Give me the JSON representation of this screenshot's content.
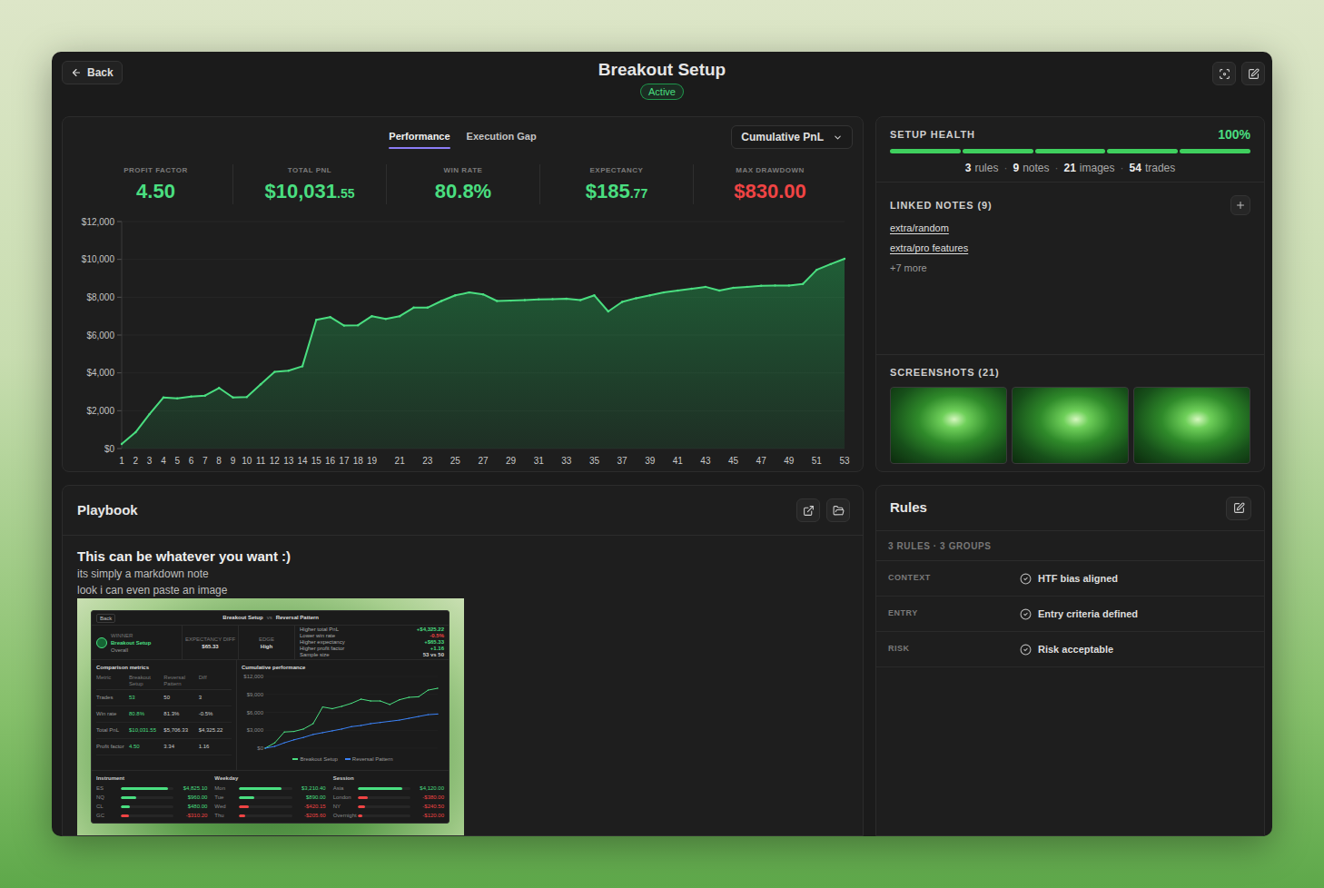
{
  "header": {
    "back": "Back",
    "title": "Breakout Setup",
    "status": "Active"
  },
  "performance": {
    "tabs": [
      {
        "label": "Performance",
        "selected": true
      },
      {
        "label": "Execution Gap",
        "selected": false
      }
    ],
    "dropdown": "Cumulative PnL",
    "stats": [
      {
        "label": "PROFIT FACTOR",
        "value": "4.50",
        "color": "#4ade80"
      },
      {
        "label": "TOTAL PNL",
        "value": "$10,031",
        "cents": ".55",
        "color": "#4ade80"
      },
      {
        "label": "WIN RATE",
        "value": "80.8%",
        "color": "#4ade80"
      },
      {
        "label": "EXPECTANCY",
        "value": "$185",
        "cents": ".77",
        "color": "#4ade80"
      },
      {
        "label": "MAX DRAWDOWN",
        "value": "$830.00",
        "color": "#ef4444"
      }
    ],
    "chart": {
      "y_ticks": [
        "$12,000",
        "$10,000",
        "$8,000",
        "$6,000",
        "$4,000",
        "$2,000",
        "$0"
      ],
      "x_labels": [
        "1",
        "2",
        "3",
        "4",
        "5",
        "6",
        "7",
        "8",
        "9",
        "10",
        "11",
        "12",
        "13",
        "14",
        "15",
        "16",
        "17",
        "18",
        "19",
        "21",
        "23",
        "25",
        "27",
        "29",
        "31",
        "33",
        "35",
        "37",
        "39",
        "41",
        "43",
        "45",
        "47",
        "49",
        "51",
        "53"
      ],
      "series": {
        "values": [
          240,
          860,
          1820,
          2700,
          2650,
          2750,
          2800,
          3200,
          2700,
          2720,
          3400,
          4050,
          4120,
          4350,
          6800,
          6950,
          6500,
          6520,
          7000,
          6850,
          7000,
          7450,
          7450,
          7800,
          8100,
          8250,
          8150,
          7800,
          7820,
          7850,
          7880,
          7900,
          7920,
          7850,
          8100,
          7250,
          7750,
          7950,
          8100,
          8250,
          8350,
          8450,
          8550,
          8350,
          8500,
          8550,
          8600,
          8620,
          8620,
          8700,
          9450,
          9750,
          10031.55
        ]
      }
    }
  },
  "health": {
    "title": "SETUP HEALTH",
    "percent": "100%",
    "segments": [
      {
        "level": 1
      },
      {
        "level": 1
      },
      {
        "level": 1
      },
      {
        "level": 1
      },
      {
        "level": 1
      }
    ],
    "separator": "·",
    "counts": [
      {
        "value": "3",
        "label": "rules"
      },
      {
        "value": "9",
        "label": "notes"
      },
      {
        "value": "21",
        "label": "images"
      },
      {
        "value": "54",
        "label": "trades"
      }
    ]
  },
  "notes": {
    "title": "LINKED NOTES (9)",
    "items": [
      "extra/random",
      "extra/pro features"
    ],
    "more": "+7 more"
  },
  "screenshots": {
    "title": "SCREENSHOTS (21)",
    "thumbnails": [
      {
        "kind": "image"
      },
      {
        "kind": "image"
      },
      {
        "kind": "image"
      }
    ]
  },
  "playbook": {
    "title": "Playbook",
    "heading": "This can be whatever you want :)",
    "lines": [
      "its simply a markdown note",
      "look i can even paste an image"
    ],
    "embed": {
      "back": "Back",
      "title": "Breakout Setup",
      "vs": "vs",
      "compare": "Reversal Pattern",
      "winner": {
        "label": "WINNER",
        "name": "Breakout Setup",
        "note": "Overall"
      },
      "summary": [
        {
          "label": "EXPECTANCY DIFF",
          "value": "$65.33"
        },
        {
          "label": "EDGE",
          "value": "High"
        }
      ],
      "highlights": [
        {
          "text": "Higher total PnL",
          "value": "+$4,325.22",
          "color": "#4ade80"
        },
        {
          "text": "Lower win rate",
          "value": "-0.5%",
          "color": "#ef4444"
        },
        {
          "text": "Higher expectancy",
          "value": "+$65.33",
          "color": "#4ade80"
        },
        {
          "text": "Higher profit factor",
          "value": "+1.16",
          "color": "#4ade80"
        },
        {
          "text": "Sample size",
          "value": "53 vs 50",
          "color": "#d4d4d4"
        }
      ],
      "metrics": {
        "title": "Comparison metrics",
        "columns": [
          "Metric",
          "Breakout Setup",
          "Reversal Pattern",
          "Diff"
        ],
        "rows": [
          [
            "Trades",
            "53",
            "50",
            "3"
          ],
          [
            "Win rate",
            "80.8%",
            "81.3%",
            "-0.5%"
          ],
          [
            "Total PnL",
            "$10,031.55",
            "$5,706.33",
            "$4,325.22"
          ],
          [
            "Profit factor",
            "4.50",
            "3.34",
            "1.16"
          ]
        ]
      },
      "chart": {
        "title": "Cumulative performance",
        "y_ticks": [
          "$12,000",
          "$9,000",
          "$6,000",
          "$3,000",
          "$0"
        ],
        "series": [
          {
            "name": "Breakout Setup",
            "color": "#4ade80",
            "values": [
              0,
              900,
              2700,
              2800,
              3200,
              4100,
              6900,
              6600,
              7000,
              7500,
              8200,
              7900,
              7900,
              7300,
              8100,
              8500,
              8600,
              9700,
              10031
            ]
          },
          {
            "name": "Reversal Pattern",
            "color": "#3b82f6",
            "values": [
              0,
              300,
              900,
              1400,
              1800,
              2300,
              2600,
              2900,
              3200,
              3600,
              3800,
              4100,
              4300,
              4500,
              4700,
              5000,
              5300,
              5600,
              5706
            ]
          }
        ]
      },
      "breakdowns": [
        {
          "title": "Instrument",
          "items": [
            {
              "label": "ES",
              "value": "$4,825.10",
              "level": 0.9,
              "color": "#4ade80"
            },
            {
              "label": "NQ",
              "value": "$960.00",
              "level": 0.3,
              "color": "#4ade80"
            },
            {
              "label": "CL",
              "value": "$480.00",
              "level": 0.18,
              "color": "#4ade80"
            },
            {
              "label": "GC",
              "value": "-$310.20",
              "level": 0.15,
              "color": "#ef4444"
            }
          ]
        },
        {
          "title": "Weekday",
          "items": [
            {
              "label": "Mon",
              "value": "$3,210.40",
              "level": 0.8,
              "color": "#4ade80"
            },
            {
              "label": "Tue",
              "value": "$890.00",
              "level": 0.28,
              "color": "#4ade80"
            },
            {
              "label": "Wed",
              "value": "-$420.15",
              "level": 0.18,
              "color": "#ef4444"
            },
            {
              "label": "Thu",
              "value": "-$205.60",
              "level": 0.12,
              "color": "#ef4444"
            }
          ]
        },
        {
          "title": "Session",
          "items": [
            {
              "label": "Asia",
              "value": "$4,120.00",
              "level": 0.85,
              "color": "#4ade80"
            },
            {
              "label": "London",
              "value": "-$380.00",
              "level": 0.2,
              "color": "#ef4444"
            },
            {
              "label": "NY",
              "value": "-$240.50",
              "level": 0.14,
              "color": "#ef4444"
            },
            {
              "label": "Overnight",
              "value": "-$120.00",
              "level": 0.1,
              "color": "#ef4444"
            }
          ]
        }
      ]
    }
  },
  "rules": {
    "title": "Rules",
    "summary": "3 RULES · 3 GROUPS",
    "groups": [
      {
        "name": "CONTEXT",
        "rules": [
          {
            "text": "HTF bias aligned",
            "checked": true
          }
        ]
      },
      {
        "name": "ENTRY",
        "rules": [
          {
            "text": "Entry criteria defined",
            "checked": true
          }
        ]
      },
      {
        "name": "RISK",
        "rules": [
          {
            "text": "Risk acceptable",
            "checked": true
          }
        ]
      }
    ]
  }
}
